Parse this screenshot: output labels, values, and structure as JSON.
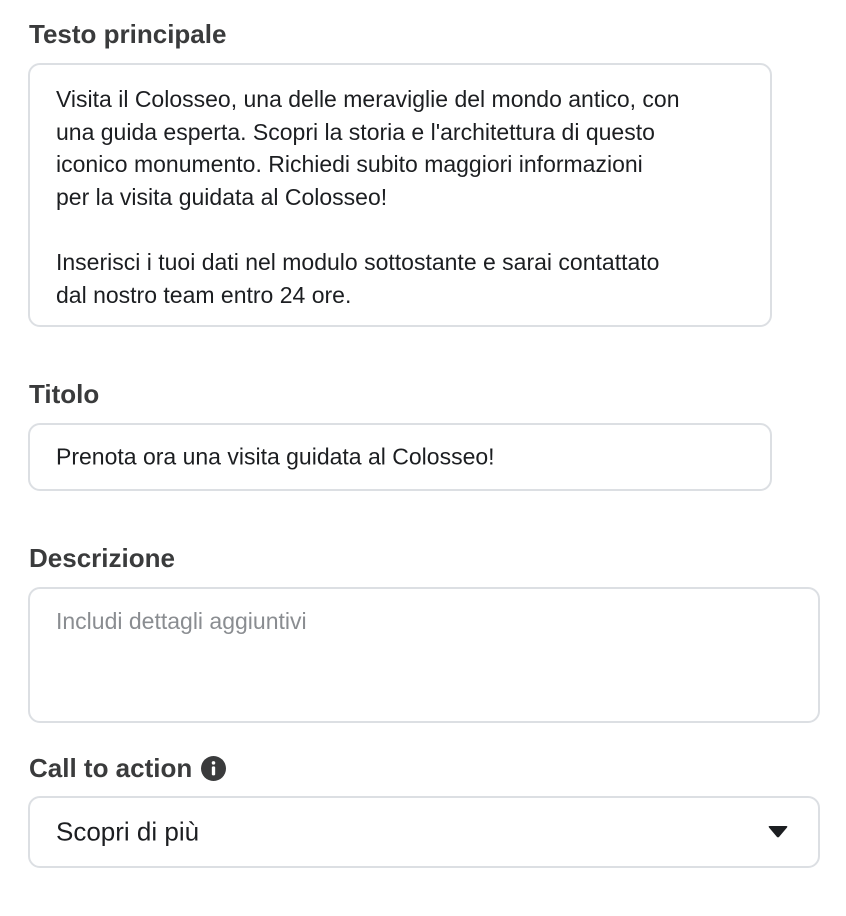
{
  "primary_text": {
    "label": "Testo principale",
    "value": "Visita il Colosseo, una delle meraviglie del mondo antico, con\nuna guida esperta. Scopri la storia e l'architettura di questo\niconico monumento. Richiedi subito maggiori informazioni\nper la visita guidata al Colosseo!\n\nInserisci i tuoi dati nel modulo sottostante e sarai contattato\ndal nostro team entro 24 ore."
  },
  "headline": {
    "label": "Titolo",
    "value": "Prenota ora una visita guidata al Colosseo!"
  },
  "description": {
    "label": "Descrizione",
    "placeholder": "Includi dettagli aggiuntivi",
    "value": ""
  },
  "call_to_action": {
    "label": "Call to action",
    "info_icon": "info-icon",
    "selected": "Scopri di più",
    "dropdown_icon": "caret-down-icon"
  },
  "colors": {
    "label_text": "#3a3b3c",
    "body_text": "#1c1e21",
    "placeholder_text": "#8a8d91",
    "border": "#dcdfe3"
  }
}
